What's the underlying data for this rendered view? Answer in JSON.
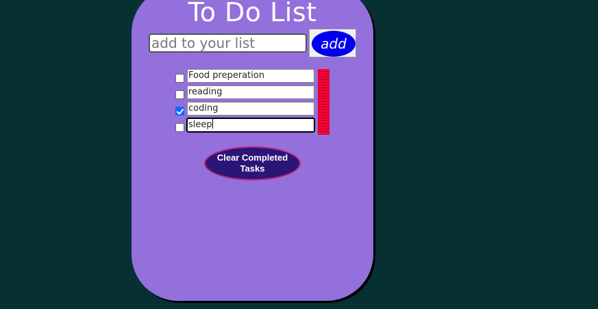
{
  "app": {
    "title": "To Do List"
  },
  "add_form": {
    "input_value": "",
    "input_placeholder": "add to your list",
    "add_label": "add"
  },
  "todos": [
    {
      "text": "Food preperation",
      "checked": false,
      "focused": false
    },
    {
      "text": "reading",
      "checked": false,
      "focused": false
    },
    {
      "text": "coding",
      "checked": true,
      "focused": false
    },
    {
      "text": "sleep",
      "checked": false,
      "focused": true
    }
  ],
  "clear_button": {
    "label": "Clear Completed Tasks"
  },
  "colors": {
    "background": "#073033",
    "card": "#9370db",
    "add_button": "#0000ee",
    "clear_button": "#2b1577",
    "clear_button_border": "#c0287a",
    "delete_bar": "#ff0033",
    "checkbox_checked": "#0a6cff"
  },
  "icons": {
    "delete": "delete-bar-icon",
    "checkbox": "checkbox-icon"
  }
}
